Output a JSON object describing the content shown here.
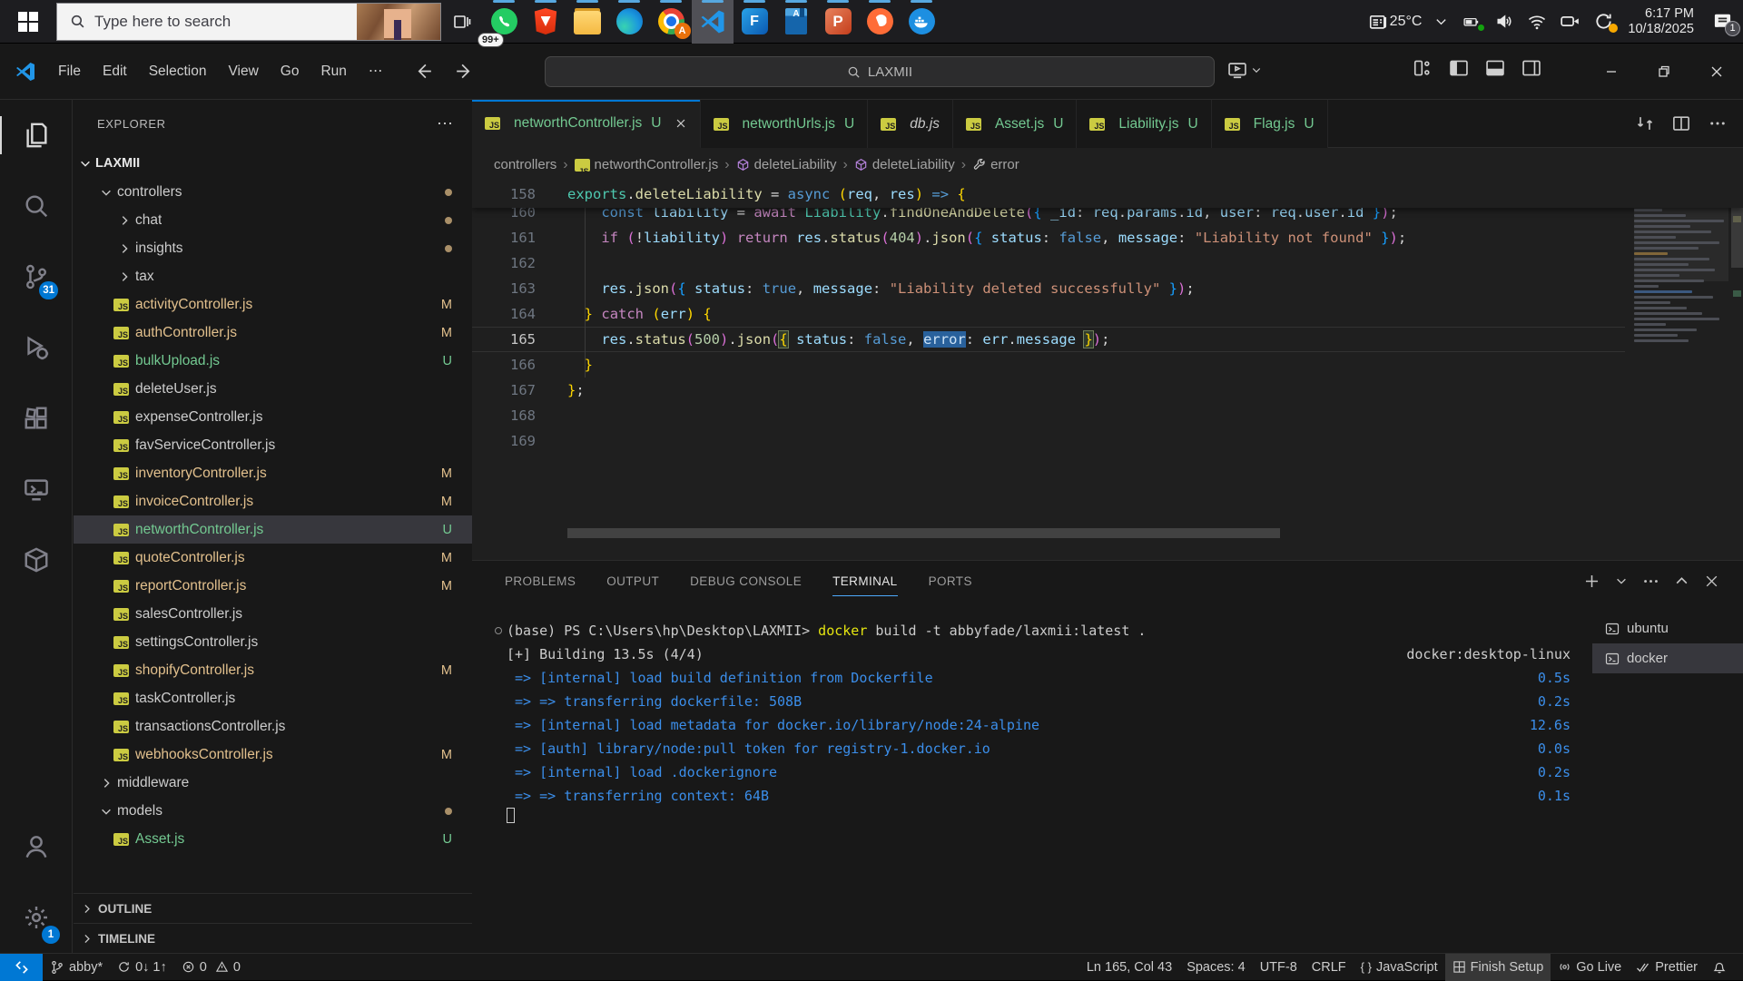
{
  "colors": {
    "accent": "#0078d4",
    "taskbar_indicator": "#57a8e0",
    "git_modified": "#e2c08d",
    "git_untracked": "#73c991",
    "terminal_blue": "#3b8eea",
    "terminal_yellow": "#e5e510"
  },
  "taskbar": {
    "search_placeholder": "Type here to search",
    "apps": [
      {
        "icon": "whatsapp",
        "badge": "99+"
      },
      {
        "icon": "brave"
      },
      {
        "icon": "file-explorer"
      },
      {
        "icon": "edge"
      },
      {
        "icon": "chrome",
        "sub_badge": "A"
      },
      {
        "icon": "vscode",
        "active": true
      },
      {
        "icon": "flow-app"
      },
      {
        "icon": "reader-book"
      },
      {
        "icon": "powerpoint"
      },
      {
        "icon": "postman"
      },
      {
        "icon": "docker"
      }
    ],
    "tray": {
      "temperature": "25°C",
      "time": "6:17 PM",
      "date": "10/18/2025",
      "notification_count": "1"
    }
  },
  "titlebar": {
    "menus": [
      "File",
      "Edit",
      "Selection",
      "View",
      "Go",
      "Run",
      "⋯"
    ],
    "command_center": "LAXMII"
  },
  "activitybar": {
    "items": [
      {
        "icon": "files",
        "active": true
      },
      {
        "icon": "search"
      },
      {
        "icon": "source-control",
        "badge": "31"
      },
      {
        "icon": "run-debug"
      },
      {
        "icon": "extensions"
      },
      {
        "icon": "remote-explorer"
      },
      {
        "icon": "package"
      }
    ],
    "bottom": [
      {
        "icon": "account"
      },
      {
        "icon": "settings",
        "badge": "1"
      }
    ]
  },
  "explorer": {
    "title": "EXPLORER",
    "section": "LAXMII",
    "items": [
      {
        "indent": 1,
        "chevron": "down",
        "label": "controllers",
        "marker": "dot"
      },
      {
        "indent": 2,
        "chevron": "right",
        "label": "chat",
        "marker": "dot"
      },
      {
        "indent": 2,
        "chevron": "right",
        "label": "insights",
        "marker": "dot"
      },
      {
        "indent": 2,
        "chevron": "right",
        "label": "tax"
      },
      {
        "indent": 2,
        "file": true,
        "label": "activityController.js",
        "marker": "M",
        "color": "m"
      },
      {
        "indent": 2,
        "file": true,
        "label": "authController.js",
        "marker": "M",
        "color": "m"
      },
      {
        "indent": 2,
        "file": true,
        "label": "bulkUpload.js",
        "marker": "U",
        "color": "u"
      },
      {
        "indent": 2,
        "file": true,
        "label": "deleteUser.js"
      },
      {
        "indent": 2,
        "file": true,
        "label": "expenseController.js"
      },
      {
        "indent": 2,
        "file": true,
        "label": "favServiceController.js"
      },
      {
        "indent": 2,
        "file": true,
        "label": "inventoryController.js",
        "marker": "M",
        "color": "m"
      },
      {
        "indent": 2,
        "file": true,
        "label": "invoiceController.js",
        "marker": "M",
        "color": "m"
      },
      {
        "indent": 2,
        "file": true,
        "label": "networthController.js",
        "marker": "U",
        "color": "u",
        "selected": true
      },
      {
        "indent": 2,
        "file": true,
        "label": "quoteController.js",
        "marker": "M",
        "color": "m"
      },
      {
        "indent": 2,
        "file": true,
        "label": "reportController.js",
        "marker": "M",
        "color": "m"
      },
      {
        "indent": 2,
        "file": true,
        "label": "salesController.js"
      },
      {
        "indent": 2,
        "file": true,
        "label": "settingsController.js"
      },
      {
        "indent": 2,
        "file": true,
        "label": "shopifyController.js",
        "marker": "M",
        "color": "m"
      },
      {
        "indent": 2,
        "file": true,
        "label": "taskController.js"
      },
      {
        "indent": 2,
        "file": true,
        "label": "transactionsController.js"
      },
      {
        "indent": 2,
        "file": true,
        "label": "webhooksController.js",
        "marker": "M",
        "color": "m"
      },
      {
        "indent": 1,
        "chevron": "right",
        "label": "middleware"
      },
      {
        "indent": 1,
        "chevron": "down",
        "label": "models",
        "marker": "dot"
      },
      {
        "indent": 2,
        "file": true,
        "label": "Asset.js",
        "marker": "U",
        "color": "u"
      }
    ],
    "outline": "OUTLINE",
    "timeline": "TIMELINE"
  },
  "tabs": [
    {
      "label": "networthController.js",
      "badge": "U",
      "active": true,
      "close": true,
      "green": true
    },
    {
      "label": "networthUrls.js",
      "badge": "U",
      "green": true
    },
    {
      "label": "db.js",
      "italic": true
    },
    {
      "label": "Asset.js",
      "badge": "U",
      "green": true
    },
    {
      "label": "Liability.js",
      "badge": "U",
      "green": true
    },
    {
      "label": "Flag.js",
      "badge": "U",
      "green": true
    }
  ],
  "breadcrumbs": [
    {
      "label": "controllers"
    },
    {
      "label": "networthController.js",
      "icon": "js"
    },
    {
      "label": "deleteLiability",
      "icon": "symbol-method"
    },
    {
      "label": "deleteLiability",
      "icon": "symbol-method"
    },
    {
      "label": "error",
      "icon": "wrench"
    }
  ],
  "code": {
    "sticky": {
      "n": "158",
      "tokens": [
        [
          "t",
          "exports"
        ],
        [
          "w",
          "."
        ],
        [
          "f",
          "deleteLiability"
        ],
        [
          "w",
          " = "
        ],
        [
          "k",
          "async"
        ],
        [
          "w",
          " "
        ],
        [
          "b1",
          "("
        ],
        [
          "v",
          "req"
        ],
        [
          "w",
          ", "
        ],
        [
          "v",
          "res"
        ],
        [
          "b1",
          ")"
        ],
        [
          "w",
          " "
        ],
        [
          "k",
          "=>"
        ],
        [
          "w",
          " "
        ],
        [
          "b1",
          "{"
        ]
      ]
    },
    "lines": [
      {
        "n": "160",
        "cut": true,
        "tokens": [
          [
            "w",
            "    "
          ],
          [
            "k",
            "const"
          ],
          [
            "w",
            " "
          ],
          [
            "v",
            "liability"
          ],
          [
            "w",
            " = "
          ],
          [
            "c",
            "await"
          ],
          [
            "w",
            " "
          ],
          [
            "t",
            "Liability"
          ],
          [
            "w",
            "."
          ],
          [
            "f",
            "findOneAndDelete"
          ],
          [
            "b2",
            "("
          ],
          [
            "b3",
            "{"
          ],
          [
            "w",
            " "
          ],
          [
            "v",
            "_id"
          ],
          [
            "w",
            ": "
          ],
          [
            "v",
            "req"
          ],
          [
            "w",
            "."
          ],
          [
            "v",
            "params"
          ],
          [
            "w",
            "."
          ],
          [
            "v",
            "id"
          ],
          [
            "w",
            ", "
          ],
          [
            "v",
            "user"
          ],
          [
            "w",
            ": "
          ],
          [
            "v",
            "req"
          ],
          [
            "w",
            "."
          ],
          [
            "v",
            "user"
          ],
          [
            "w",
            "."
          ],
          [
            "v",
            "id"
          ],
          [
            "w",
            " "
          ],
          [
            "b3",
            "}"
          ],
          [
            "b2",
            ")"
          ],
          [
            "w",
            ";"
          ]
        ]
      },
      {
        "n": "161",
        "tokens": [
          [
            "w",
            "    "
          ],
          [
            "c",
            "if"
          ],
          [
            "w",
            " "
          ],
          [
            "b2",
            "("
          ],
          [
            "w",
            "!"
          ],
          [
            "v",
            "liability"
          ],
          [
            "b2",
            ")"
          ],
          [
            "w",
            " "
          ],
          [
            "c",
            "return"
          ],
          [
            "w",
            " "
          ],
          [
            "v",
            "res"
          ],
          [
            "w",
            "."
          ],
          [
            "f",
            "status"
          ],
          [
            "b2",
            "("
          ],
          [
            "n",
            "404"
          ],
          [
            "b2",
            ")"
          ],
          [
            "w",
            "."
          ],
          [
            "f",
            "json"
          ],
          [
            "b2",
            "("
          ],
          [
            "b3",
            "{"
          ],
          [
            "w",
            " "
          ],
          [
            "v",
            "status"
          ],
          [
            "w",
            ": "
          ],
          [
            "k",
            "false"
          ],
          [
            "w",
            ", "
          ],
          [
            "v",
            "message"
          ],
          [
            "w",
            ": "
          ],
          [
            "s",
            "\"Liability not found\""
          ],
          [
            "w",
            " "
          ],
          [
            "b3",
            "}"
          ],
          [
            "b2",
            ")"
          ],
          [
            "w",
            ";"
          ]
        ]
      },
      {
        "n": "162",
        "tokens": []
      },
      {
        "n": "163",
        "tokens": [
          [
            "w",
            "    "
          ],
          [
            "v",
            "res"
          ],
          [
            "w",
            "."
          ],
          [
            "f",
            "json"
          ],
          [
            "b2",
            "("
          ],
          [
            "b3",
            "{"
          ],
          [
            "w",
            " "
          ],
          [
            "v",
            "status"
          ],
          [
            "w",
            ": "
          ],
          [
            "k",
            "true"
          ],
          [
            "w",
            ", "
          ],
          [
            "v",
            "message"
          ],
          [
            "w",
            ": "
          ],
          [
            "s",
            "\"Liability deleted successfully\""
          ],
          [
            "w",
            " "
          ],
          [
            "b3",
            "}"
          ],
          [
            "b2",
            ")"
          ],
          [
            "w",
            ";"
          ]
        ]
      },
      {
        "n": "164",
        "tokens": [
          [
            "w",
            "  "
          ],
          [
            "b1",
            "}"
          ],
          [
            "w",
            " "
          ],
          [
            "c",
            "catch"
          ],
          [
            "w",
            " "
          ],
          [
            "b1",
            "("
          ],
          [
            "v",
            "err"
          ],
          [
            "b1",
            ")"
          ],
          [
            "w",
            " "
          ],
          [
            "b1",
            "{"
          ]
        ]
      },
      {
        "n": "165",
        "current": true,
        "tokens": [
          [
            "w",
            "    "
          ],
          [
            "v",
            "res"
          ],
          [
            "w",
            "."
          ],
          [
            "f",
            "status"
          ],
          [
            "b2",
            "("
          ],
          [
            "n",
            "500"
          ],
          [
            "b2",
            ")"
          ],
          [
            "w",
            "."
          ],
          [
            "f",
            "json"
          ],
          [
            "b2",
            "("
          ],
          [
            "bm",
            "{"
          ],
          [
            "w",
            " "
          ],
          [
            "v",
            "status"
          ],
          [
            "w",
            ": "
          ],
          [
            "k",
            "false"
          ],
          [
            "w",
            ", "
          ],
          [
            "sel",
            "error"
          ],
          [
            "w",
            ": "
          ],
          [
            "v",
            "err"
          ],
          [
            "w",
            "."
          ],
          [
            "v",
            "message"
          ],
          [
            "w",
            " "
          ],
          [
            "bm",
            "}"
          ],
          [
            "b2",
            ")"
          ],
          [
            "w",
            ";"
          ]
        ]
      },
      {
        "n": "166",
        "tokens": [
          [
            "w",
            "  "
          ],
          [
            "b1",
            "}"
          ]
        ]
      },
      {
        "n": "167",
        "tokens": [
          [
            "b1",
            "}"
          ],
          [
            "w",
            ";"
          ]
        ]
      },
      {
        "n": "168",
        "tokens": []
      },
      {
        "n": "169",
        "tokens": []
      }
    ]
  },
  "panel": {
    "tabs": [
      {
        "label": "PROBLEMS"
      },
      {
        "label": "OUTPUT"
      },
      {
        "label": "DEBUG CONSOLE"
      },
      {
        "label": "TERMINAL",
        "active": true
      },
      {
        "label": "PORTS"
      }
    ],
    "terminal_lines": [
      {
        "marker": true,
        "tokens": [
          [
            "w",
            "(base) PS C:\\Users\\hp\\Desktop\\LAXMII> "
          ],
          [
            "y",
            "docker"
          ],
          [
            "w",
            " build -t abbyfade/laxmii:latest ."
          ]
        ]
      },
      {
        "tokens": [
          [
            "w",
            "[+] Building 13.5s (4/4)"
          ]
        ],
        "right": [
          "w",
          "docker:desktop-linux"
        ]
      },
      {
        "tokens": [
          [
            "b",
            " => [internal] load build definition from Dockerfile"
          ]
        ],
        "right": [
          "b",
          "0.5s"
        ]
      },
      {
        "tokens": [
          [
            "b",
            " => => transferring dockerfile: 508B"
          ]
        ],
        "right": [
          "b",
          "0.2s"
        ]
      },
      {
        "tokens": [
          [
            "b",
            " => [internal] load metadata for docker.io/library/node:24-alpine"
          ]
        ],
        "right": [
          "b",
          "12.6s"
        ]
      },
      {
        "tokens": [
          [
            "b",
            " => [auth] library/node:pull token for registry-1.docker.io"
          ]
        ],
        "right": [
          "b",
          "0.0s"
        ]
      },
      {
        "tokens": [
          [
            "b",
            " => [internal] load .dockerignore"
          ]
        ],
        "right": [
          "b",
          "0.2s"
        ]
      },
      {
        "tokens": [
          [
            "b",
            " => => transferring context: 64B"
          ]
        ],
        "right": [
          "b",
          "0.1s"
        ]
      },
      {
        "cursor": true,
        "tokens": []
      }
    ],
    "sessions": [
      {
        "label": "ubuntu"
      },
      {
        "label": "docker",
        "selected": true
      }
    ]
  },
  "statusbar": {
    "branch": "abby*",
    "sync": "0↓ 1↑",
    "errors": "0",
    "warnings": "0",
    "right": [
      {
        "label": "Ln 165, Col 43",
        "name": "cursor-position"
      },
      {
        "label": "Spaces: 4",
        "name": "indentation"
      },
      {
        "label": "UTF-8",
        "name": "encoding"
      },
      {
        "label": "CRLF",
        "name": "eol"
      },
      {
        "icon": "braces",
        "label": "JavaScript",
        "name": "language-mode"
      },
      {
        "icon": "grid4",
        "label": "Finish Setup",
        "hl": true,
        "name": "finish-setup"
      },
      {
        "icon": "golive",
        "label": "Go Live",
        "name": "go-live"
      },
      {
        "icon": "check2",
        "label": "Prettier",
        "name": "prettier"
      },
      {
        "icon": "bell",
        "label": "",
        "name": "notifications-bell"
      }
    ]
  }
}
